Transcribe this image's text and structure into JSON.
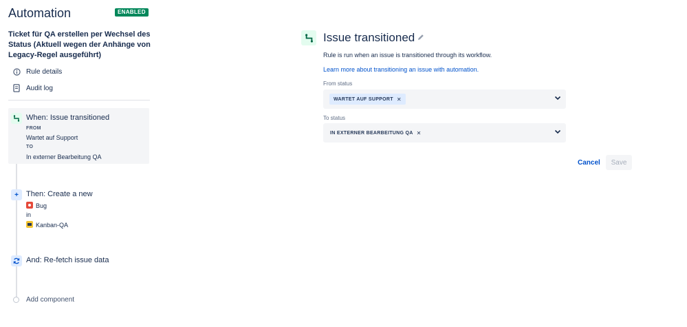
{
  "app": {
    "title": "Automation",
    "status_badge": "ENABLED"
  },
  "rule": {
    "name": "Ticket für QA erstellen per Wechsel des Status (Aktuell wegen der Anhänge von Legacy-Regel ausgeführt)"
  },
  "sidebar": {
    "links": [
      {
        "label": "Rule details",
        "icon": "info-icon"
      },
      {
        "label": "Audit log",
        "icon": "document-icon"
      }
    ]
  },
  "steps": {
    "trigger": {
      "title": "When: Issue transitioned",
      "from_caption": "FROM",
      "from_value": "Wartet auf Support",
      "to_caption": "TO",
      "to_value": "In externer Bearbeitung QA"
    },
    "action_create": {
      "title": "Then: Create a new",
      "issue_type": "Bug",
      "in_label": "in",
      "project": "Kanban-QA"
    },
    "action_refetch": {
      "title": "And: Re-fetch issue data"
    },
    "add_component": "Add component"
  },
  "main": {
    "title": "Issue transitioned",
    "description": "Rule is run when an issue is transitioned through its workflow.",
    "learn_more_link": "Learn more about transitioning an issue with automation.",
    "from_status": {
      "label": "From status",
      "selected": "WARTET AUF SUPPORT"
    },
    "to_status": {
      "label": "To status",
      "selected": "IN EXTERNER BEARBEITUNG QA"
    },
    "cancel_label": "Cancel",
    "save_label": "Save"
  },
  "colors": {
    "accent": "#0052cc",
    "enabled_badge": "#00875a",
    "bug_icon": "#e5493a",
    "chip_background": "#deebff"
  }
}
